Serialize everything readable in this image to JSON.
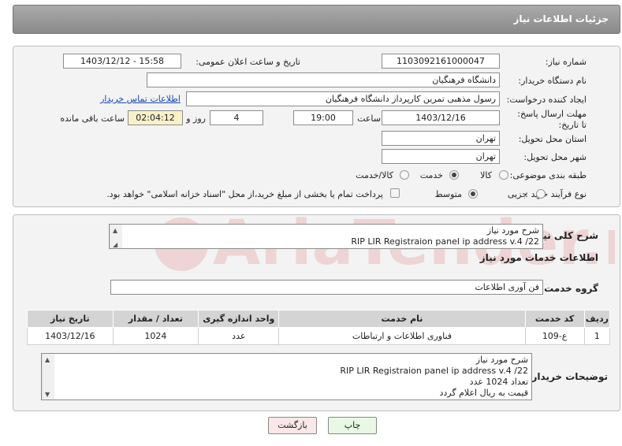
{
  "header": {
    "title": "جزئیات اطلاعات نیاز"
  },
  "form": {
    "need_number_label": "شماره نیاز:",
    "need_number": "1103092161000047",
    "announce_label": "تاریخ و ساعت اعلان عمومی:",
    "announce_value": "1403/12/12 - 15:58",
    "buyer_org_label": "نام دستگاه خریدار:",
    "buyer_org": "دانشگاه فرهنگیان",
    "creator_label": "ایجاد کننده درخواست:",
    "creator": "رسول مذهبی تمرین کارپرداز دانشگاه فرهنگیان",
    "contact_link": "اطلاعات تماس خریدار",
    "deadline_label": "مهلت ارسال پاسخ: تا تاریخ:",
    "deadline_date": "1403/12/16",
    "time_label": "ساعت",
    "deadline_time": "19:00",
    "days": "4",
    "days_label": "روز و",
    "remaining": "02:04:12",
    "remaining_label": "ساعت باقی مانده",
    "province_label": "استان محل تحویل:",
    "province": "تهران",
    "city_label": "شهر محل تحویل:",
    "city": "تهران",
    "category_label": "طبقه بندی موضوعی:",
    "category_options": [
      "کالا",
      "خدمت",
      "کالا/خدمت"
    ],
    "category_selected": "خدمت",
    "process_label": "نوع فرآیند خرید :",
    "process_options": [
      "جزیی",
      "متوسط"
    ],
    "process_selected": "متوسط",
    "payment_note": "پرداخت تمام یا بخشی از مبلغ خرید،از محل \"اسناد خزانه اسلامی\" خواهد بود."
  },
  "summary": {
    "label": "شرح کلی نیاز:",
    "lines": [
      "شرح مورد نیاز",
      "RIP LIR Registraion panel ip address v.4 /22"
    ]
  },
  "services": {
    "section_title": "اطلاعات خدمات مورد نیاز",
    "group_label": "گروه خدمت:",
    "group_value": "فن آوری اطلاعات",
    "columns": [
      "ردیف",
      "کد خدمت",
      "نام خدمت",
      "واحد اندازه گیری",
      "تعداد / مقدار",
      "تاریخ نیاز"
    ],
    "rows": [
      [
        "1",
        "ع-109",
        "فناوری اطلاعات و ارتباطات",
        "عدد",
        "1024",
        "1403/12/16"
      ]
    ]
  },
  "buyer_notes": {
    "label": "توضیحات خریدار:",
    "lines": [
      "شرح مورد نیاز",
      "RIP LIR Registraion panel ip address v.4 /22",
      "تعداد 1024 عدد",
      "قیمت به ریال اعلام گردد"
    ]
  },
  "buttons": {
    "print": "چاپ",
    "back": "بازگشت"
  },
  "watermark": {
    "text": "AriaTender.neT"
  },
  "colors": {
    "header": "#9a9a9a",
    "link": "#1747b5",
    "print_bg": "#e8f8e4",
    "back_bg": "#fbe7e7"
  }
}
